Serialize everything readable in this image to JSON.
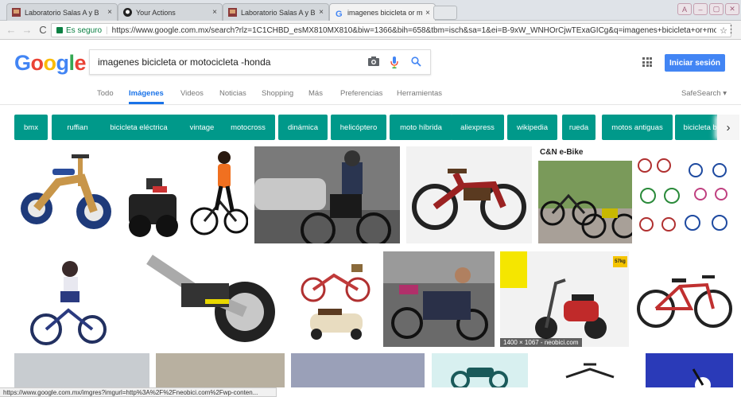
{
  "browser": {
    "tabs": [
      {
        "label": "Laboratorio Salas A y B",
        "close": "×"
      },
      {
        "label": "Your Actions",
        "close": "×"
      },
      {
        "label": "Laboratorio Salas A y B",
        "close": "×"
      },
      {
        "label": "imagenes bicicleta or moto",
        "close": "×"
      }
    ],
    "window_controls": [
      "A",
      "–",
      "▢",
      "✕"
    ],
    "nav": {
      "back": "←",
      "forward": "→",
      "reload": "C"
    },
    "secure_label": "Es seguro",
    "separator": "|",
    "url": "https://www.google.com.mx/search?rlz=1C1CHBD_esMX810MX810&biw=1366&bih=658&tbm=isch&sa=1&ei=B-9xW_WNHOrCjwTExaGICg&q=imagenes+bicicleta+or+moto...",
    "star": "☆",
    "menu": "⋮"
  },
  "header": {
    "logo_letters": [
      "G",
      "o",
      "o",
      "g",
      "l",
      "e"
    ],
    "search_query": "imagenes bicicleta or motocicleta -honda",
    "signin_label": "Iniciar sesión"
  },
  "nav_tabs": [
    "Todo",
    "Imágenes",
    "Videos",
    "Noticias",
    "Shopping",
    "Más",
    "Preferencias",
    "Herramientas"
  ],
  "safesearch_label": "SafeSearch ▾",
  "chips": [
    "bmx",
    "ruffian",
    "bicicleta eléctrica",
    "vintage",
    "motocross",
    "dinámica",
    "helicóptero",
    "moto híbrida",
    "aliexpress",
    "wikipedia",
    "rueda",
    "motos antiguas",
    "bicicleta bmx"
  ],
  "chip_arrow": "›",
  "image_texts": {
    "cn_ebike": "C&N e-Bike",
    "neobici_meta": "1400 × 1067 - neobici.com",
    "kg_badge": "57kg"
  },
  "status_url": "https://www.google.com.mx/imgres?imgurl=http%3A%2F%2Fneobici.com%2Fwp-conten...",
  "colors": {
    "chip": "#00998a",
    "accent": "#1a73e8",
    "signin": "#4285f4"
  }
}
